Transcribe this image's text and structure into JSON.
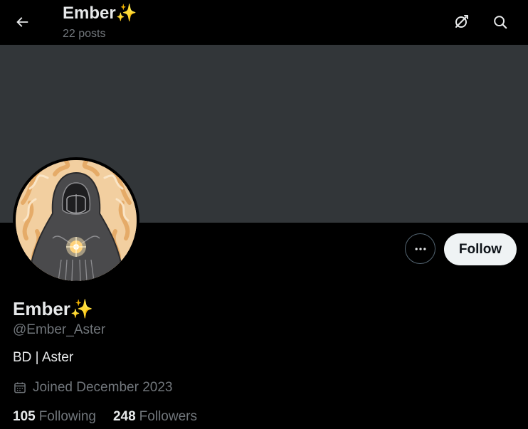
{
  "header": {
    "back_icon": "arrow-left-icon",
    "title": "Ember✨",
    "posts_count": "22 posts",
    "actions": [
      {
        "name": "no-grok-icon"
      },
      {
        "name": "search-icon"
      }
    ]
  },
  "profile": {
    "display_name": "Ember✨",
    "handle": "@Ember_Aster",
    "bio": "BD | Aster",
    "joined": "Joined December 2023",
    "following_count": "105",
    "following_label": "Following",
    "followers_count": "248",
    "followers_label": "Followers",
    "follow_button_label": "Follow"
  },
  "colors": {
    "background": "#000000",
    "banner": "#323639",
    "text_primary": "#e7e9ea",
    "text_secondary": "#71767b",
    "follow_bg": "#eff3f4",
    "avatar_bg": "#f2cfa0"
  }
}
